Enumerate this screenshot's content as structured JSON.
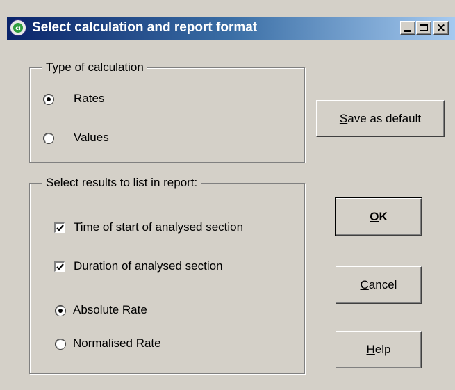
{
  "window": {
    "title": "Select calculation and report format",
    "icon": "app-logo-icon",
    "icon_text": "ci",
    "controls": [
      "minimize-icon",
      "maximize-icon",
      "close-icon"
    ]
  },
  "calc_group": {
    "title": "Type of calculation",
    "options": [
      {
        "label": "Rates",
        "selected": true
      },
      {
        "label": "Values",
        "selected": false
      }
    ]
  },
  "report_group": {
    "title": "Select results to list in report:",
    "checkboxes": [
      {
        "label": "Time of start of analysed section",
        "checked": true
      },
      {
        "label": "Duration of analysed section",
        "checked": true
      }
    ],
    "radios": [
      {
        "label": "Absolute Rate",
        "selected": true
      },
      {
        "label": "Normalised Rate",
        "selected": false
      }
    ]
  },
  "buttons": {
    "save_default": {
      "mnemonic": "S",
      "rest": "ave as default"
    },
    "ok": {
      "mnemonic": "O",
      "rest": "K"
    },
    "cancel": {
      "mnemonic": "C",
      "rest": "ancel"
    },
    "help": {
      "mnemonic": "H",
      "rest": "elp"
    }
  },
  "colors": {
    "face": "#d4d0c8",
    "title_start": "#0a246a",
    "title_end": "#a6caf0",
    "title_text": "#ffffff"
  }
}
